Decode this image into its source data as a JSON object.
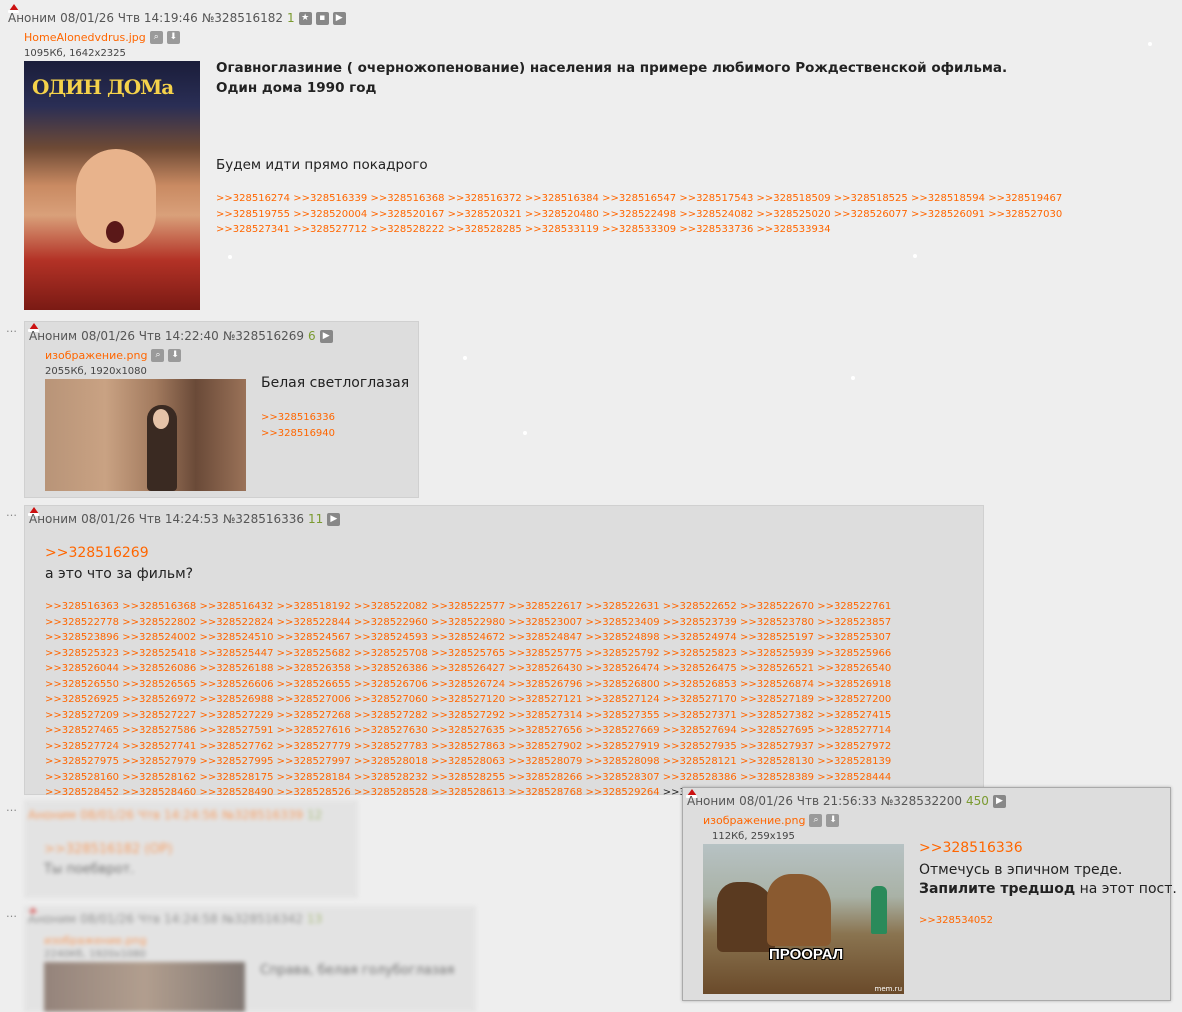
{
  "op": {
    "author": "Аноним",
    "date": "08/01/26 Чтв 14:19:46",
    "num": "№328516182",
    "count": "1",
    "file": {
      "name": "HomeAlonedvdrus.jpg",
      "size": "1095Кб, 1642x2325"
    },
    "poster_title": "ОДИН ДОМа",
    "msg1": "Огавноглазиние ( очерножопенование) населения на примере любимого Рождественской офильма.",
    "msg2": "Один дома 1990 год",
    "msg3": "Будем идти прямо покадрого",
    "replies": [
      ">>328516274",
      ">>328516339",
      ">>328516368",
      ">>328516372",
      ">>328516384",
      ">>328516547",
      ">>328517543",
      ">>328518509",
      ">>328518525",
      ">>328518594",
      ">>328519467",
      ">>328519755",
      ">>328520004",
      ">>328520167",
      ">>328520321",
      ">>328520480",
      ">>328522498",
      ">>328524082",
      ">>328525020",
      ">>328526077",
      ">>328526091",
      ">>328527030",
      ">>328527341",
      ">>328527712",
      ">>328528222",
      ">>328528285",
      ">>328533119",
      ">>328533309",
      ">>328533736",
      ">>328533934"
    ]
  },
  "p2": {
    "author": "Аноним",
    "date": "08/01/26 Чтв 14:22:40",
    "num": "№328516269",
    "count": "6",
    "file": {
      "name": "изображение.png",
      "size": "2055Кб, 1920x1080"
    },
    "msg": "Белая светлоглазая",
    "replies": [
      ">>328516336",
      ">>328516940"
    ]
  },
  "p3": {
    "author": "Аноним",
    "date": "08/01/26 Чтв 14:24:53",
    "num": "№328516336",
    "count": "11",
    "quote": ">>328516269",
    "msg": "а это что за фильм?",
    "replies": [
      ">>328516363",
      ">>328516368",
      ">>328516432",
      ">>328518192",
      ">>328522082",
      ">>328522577",
      ">>328522617",
      ">>328522631",
      ">>328522652",
      ">>328522670",
      ">>328522761",
      ">>328522778",
      ">>328522802",
      ">>328522824",
      ">>328522844",
      ">>328522960",
      ">>328522980",
      ">>328523007",
      ">>328523409",
      ">>328523739",
      ">>328523780",
      ">>328523857",
      ">>328523896",
      ">>328524002",
      ">>328524510",
      ">>328524567",
      ">>328524593",
      ">>328524672",
      ">>328524847",
      ">>328524898",
      ">>328524974",
      ">>328525197",
      ">>328525307",
      ">>328525323",
      ">>328525418",
      ">>328525447",
      ">>328525682",
      ">>328525708",
      ">>328525765",
      ">>328525775",
      ">>328525792",
      ">>328525823",
      ">>328525939",
      ">>328525966",
      ">>328526044",
      ">>328526086",
      ">>328526188",
      ">>328526358",
      ">>328526386",
      ">>328526427",
      ">>328526430",
      ">>328526474",
      ">>328526475",
      ">>328526521",
      ">>328526540",
      ">>328526550",
      ">>328526565",
      ">>328526606",
      ">>328526655",
      ">>328526706",
      ">>328526724",
      ">>328526796",
      ">>328526800",
      ">>328526853",
      ">>328526874",
      ">>328526918",
      ">>328526925",
      ">>328526972",
      ">>328526988",
      ">>328527006",
      ">>328527060",
      ">>328527120",
      ">>328527121",
      ">>328527124",
      ">>328527170",
      ">>328527189",
      ">>328527200",
      ">>328527209",
      ">>328527227",
      ">>328527229",
      ">>328527268",
      ">>328527282",
      ">>328527292",
      ">>328527314",
      ">>328527355",
      ">>328527371",
      ">>328527382",
      ">>328527415",
      ">>328527465",
      ">>328527586",
      ">>328527591",
      ">>328527616",
      ">>328527630",
      ">>328527635",
      ">>328527656",
      ">>328527669",
      ">>328527694",
      ">>328527695",
      ">>328527714",
      ">>328527724",
      ">>328527741",
      ">>328527762",
      ">>328527779",
      ">>328527783",
      ">>328527863",
      ">>328527902",
      ">>328527919",
      ">>328527935",
      ">>328527937",
      ">>328527972",
      ">>328527975",
      ">>328527979",
      ">>328527995",
      ">>328527997",
      ">>328528018",
      ">>328528063",
      ">>328528079",
      ">>328528098",
      ">>328528121",
      ">>328528130",
      ">>328528139",
      ">>328528160",
      ">>328528162",
      ">>328528175",
      ">>328528184",
      ">>328528232",
      ">>328528255",
      ">>328528266",
      ">>328528307",
      ">>328528386",
      ">>328528389",
      ">>328528444",
      ">>328528452",
      ">>328528460",
      ">>328528490",
      ">>328528526",
      ">>328528528",
      ">>328528613",
      ">>328528768",
      ">>328529264"
    ],
    "last_reply": ">>328532200"
  },
  "p4": {
    "author": "Аноним",
    "date": "08/01/26 Чтв 14:24:56",
    "num": "№328516339",
    "count": "12",
    "quote": ">>328516182 (OP)",
    "msg": "Ты поебврот."
  },
  "p5": {
    "author": "Аноним",
    "date": "08/01/26 Чтв 14:24:58",
    "num": "№328516342",
    "count": "13",
    "file": {
      "name": "изображение.png",
      "size": "2240Кб, 1920x1080"
    },
    "msg": "Справа, белая голубоглазая"
  },
  "popup": {
    "author": "Аноним",
    "date": "08/01/26 Чтв 21:56:33",
    "num": "№328532200",
    "count": "450",
    "file": {
      "name": "изображение.png",
      "size": "112Кб, 259x195"
    },
    "quote": ">>328516336",
    "msg1": "Отмечусь в эпичном треде.",
    "msg2_bold": "Запилите тредшод",
    "msg2_rest": " на этот пост.",
    "img_caption": "ПРООРАЛ",
    "img_watermark": "mem.ru",
    "replies": [
      ">>328534052"
    ]
  },
  "ui": {
    "dots": "…",
    "op_thumb_alt": "poster",
    "icons": {
      "star": "★",
      "menu": "▪",
      "play": "▶",
      "search": "🔍",
      "download": "⬇"
    }
  },
  "colors": {
    "link": "#ff6600",
    "count": "#7a9a2f",
    "reply_bg": "#dddddd",
    "page_bg": "#eeeeee"
  }
}
